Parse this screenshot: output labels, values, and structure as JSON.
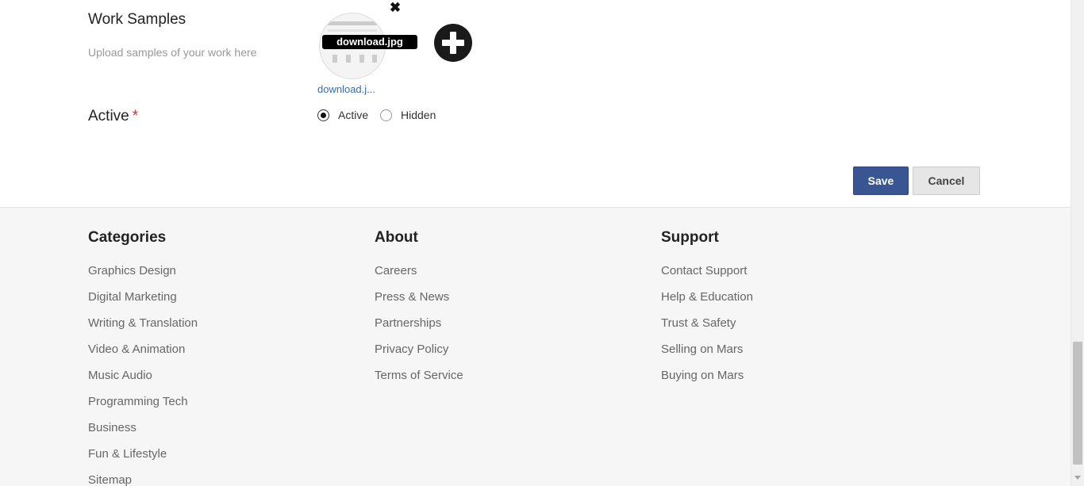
{
  "work_samples": {
    "title": "Work Samples",
    "subtitle": "Upload samples of your work here",
    "file_tooltip": "download.jpg",
    "file_name": "download.j...",
    "remove_icon": "close-icon",
    "add_icon": "plus-circle-icon"
  },
  "active": {
    "label": "Active",
    "required_marker": "*",
    "options": [
      {
        "label": "Active",
        "selected": true
      },
      {
        "label": "Hidden",
        "selected": false
      }
    ]
  },
  "actions": {
    "save_label": "Save",
    "cancel_label": "Cancel",
    "save_color": "#3a5692"
  },
  "footer": {
    "categories": {
      "title": "Categories",
      "links": [
        "Graphics Design",
        "Digital Marketing",
        "Writing & Translation",
        "Video & Animation",
        "Music Audio",
        "Programming Tech",
        "Business",
        "Fun & Lifestyle",
        "Sitemap"
      ]
    },
    "about": {
      "title": "About",
      "links": [
        "Careers",
        "Press & News",
        "Partnerships",
        "Privacy Policy",
        "Terms of Service"
      ]
    },
    "support": {
      "title": "Support",
      "links": [
        "Contact Support",
        "Help & Education",
        "Trust & Safety",
        "Selling on Mars",
        "Buying on Mars"
      ]
    }
  }
}
